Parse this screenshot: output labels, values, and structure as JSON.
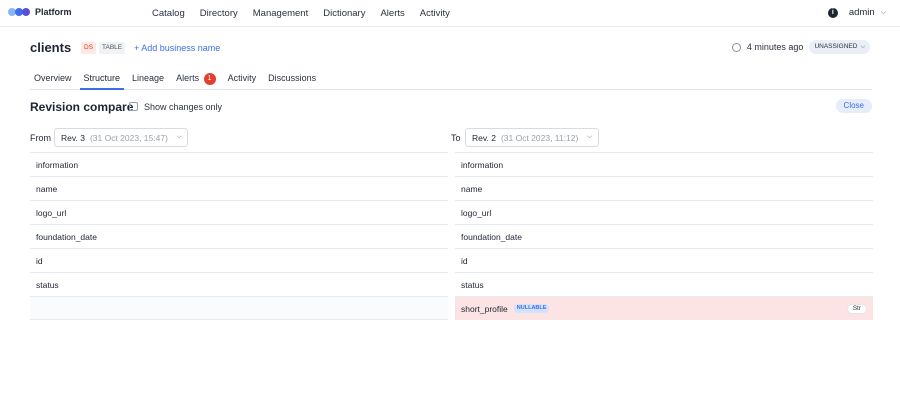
{
  "topnav": {
    "brand": "Platform",
    "logo_colors": [
      "#3b6ee8",
      "#8ab4f8",
      "#5b4fd9"
    ],
    "items": [
      "Catalog",
      "Directory",
      "Management",
      "Dictionary",
      "Alerts",
      "Activity"
    ],
    "info_icon": "info-icon",
    "info_glyph": "i",
    "user": "admin"
  },
  "header": {
    "title": "clients",
    "badge_ds": "DS",
    "badge_type": "TABLE",
    "add_business_name": "+ Add business name",
    "updated": "4 minutes ago",
    "owner": "UNASSIGNED"
  },
  "tabs": [
    {
      "label": "Overview"
    },
    {
      "label": "Structure",
      "active": true
    },
    {
      "label": "Lineage"
    },
    {
      "label": "Alerts",
      "count": "1"
    },
    {
      "label": "Activity"
    },
    {
      "label": "Discussions"
    }
  ],
  "compare": {
    "title": "Revision compare",
    "show_changes_label": "Show changes only",
    "close_label": "Close",
    "from_label": "From",
    "to_label": "To",
    "from_rev": {
      "name": "Rev. 3",
      "date": "(31 Oct 2023, 15:47)"
    },
    "to_rev": {
      "name": "Rev. 2",
      "date": "(31 Oct 2023, 11:12)"
    },
    "left_fields": [
      "information",
      "name",
      "logo_url",
      "foundation_date",
      "id",
      "status"
    ],
    "right_fields": [
      "information",
      "name",
      "logo_url",
      "foundation_date",
      "id",
      "status"
    ],
    "added_field": {
      "name": "short_profile",
      "badge": "NULLABLE",
      "type": "Str"
    },
    "added_color": "#fde4e4",
    "accent": "#3b6ee8"
  }
}
